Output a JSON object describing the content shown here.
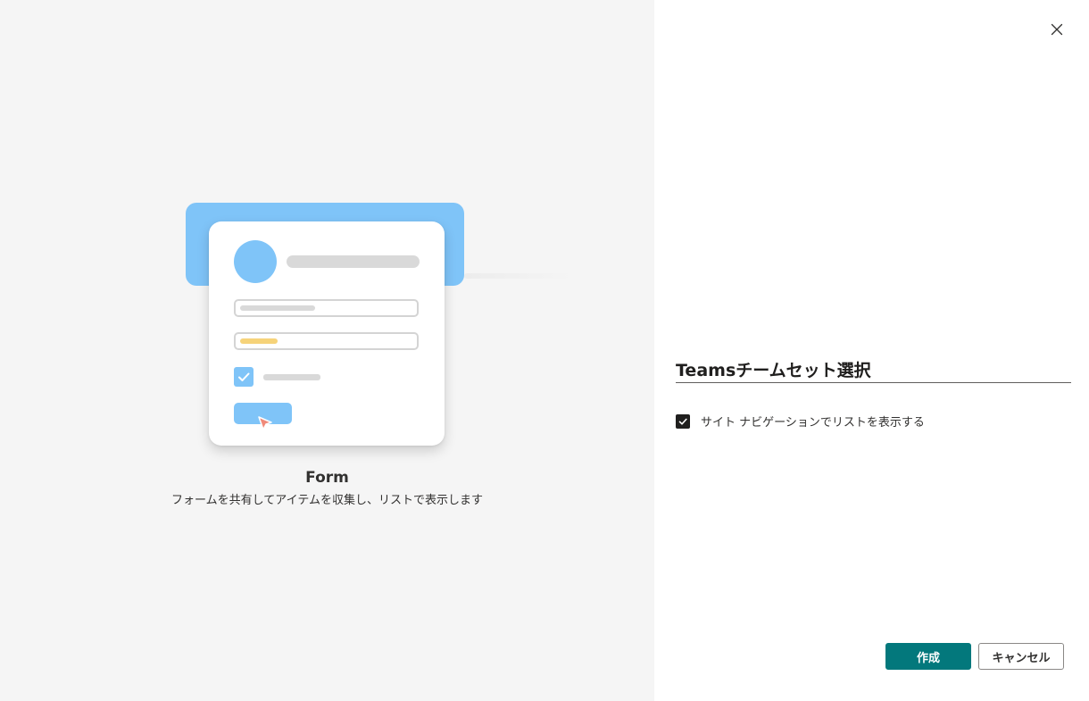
{
  "template": {
    "title": "Form",
    "description": "フォームを共有してアイテムを収集し、リストで表示します"
  },
  "form": {
    "name_value": "Teamsチームセット選択",
    "show_in_nav_label": "サイト ナビゲーションでリストを表示する",
    "show_in_nav_checked": true
  },
  "actions": {
    "create_label": "作成",
    "cancel_label": "キャンセル"
  },
  "icons": {
    "close": "close-icon",
    "check": "checkmark-icon"
  },
  "colors": {
    "accent": "#03787c",
    "illustration_blue": "#7fc4f8",
    "illustration_yellow": "#f6d37a",
    "cursor": "#f08a7a"
  }
}
